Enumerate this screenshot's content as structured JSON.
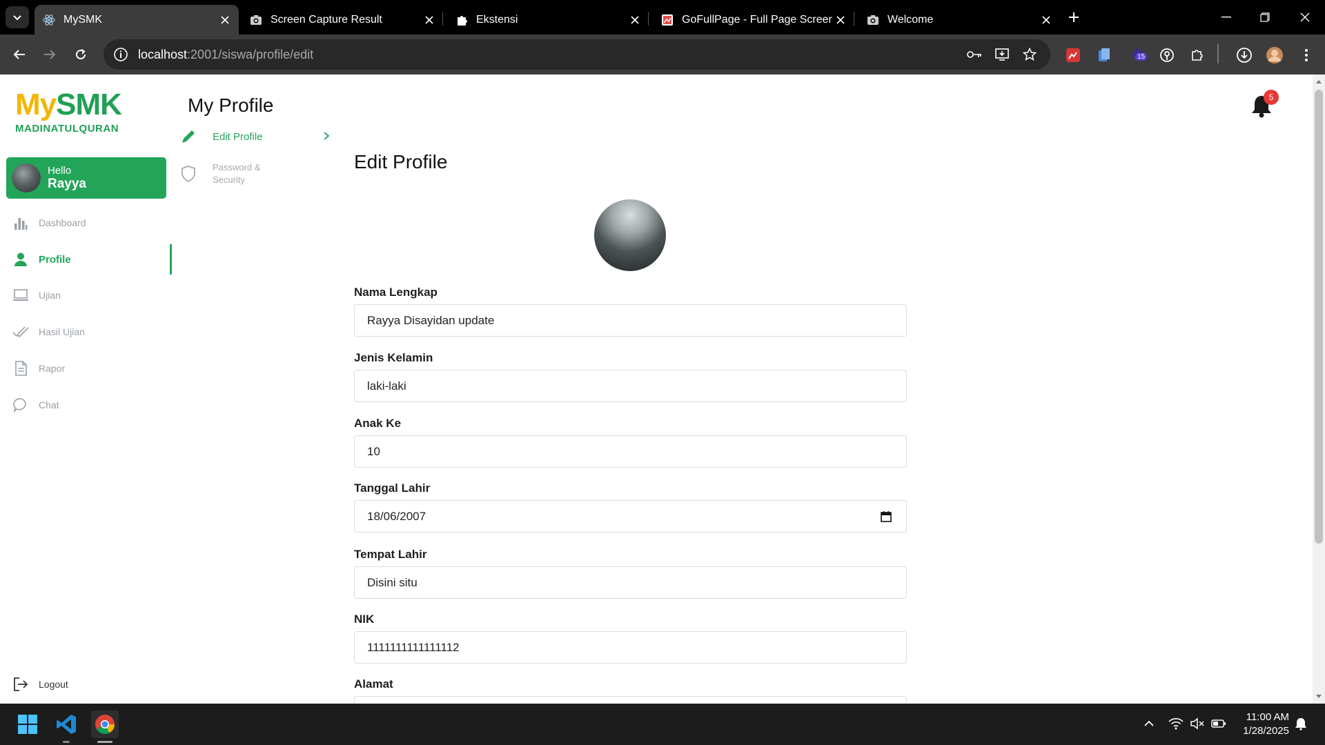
{
  "browser": {
    "tabs": [
      {
        "label": "MySMK",
        "icon": "react-icon",
        "active": true
      },
      {
        "label": "Screen Capture Result",
        "icon": "camera-icon",
        "active": false
      },
      {
        "label": "Ekstensi",
        "icon": "puzzle-icon",
        "active": false
      },
      {
        "label": "GoFullPage - Full Page Screen C",
        "icon": "gofullpage-icon",
        "active": false
      },
      {
        "label": "Welcome",
        "icon": "camera-icon",
        "active": false
      }
    ],
    "url_host": "localhost",
    "url_path": ":2001/siswa/profile/edit",
    "extension_badge": "15"
  },
  "sidebar": {
    "logo_my": "My",
    "logo_smk": "SMK",
    "logo_school": "MADINATULQURAN",
    "greeting": "Hello",
    "username": "Rayya",
    "items": [
      {
        "label": "Dashboard",
        "icon": "bar-chart-icon",
        "active": false
      },
      {
        "label": "Profile",
        "icon": "user-icon",
        "active": true
      },
      {
        "label": "Ujian",
        "icon": "laptop-icon",
        "active": false
      },
      {
        "label": "Hasil Ujian",
        "icon": "check-icon",
        "active": false
      },
      {
        "label": "Rapor",
        "icon": "document-icon",
        "active": false
      },
      {
        "label": "Chat",
        "icon": "chat-icon",
        "active": false
      }
    ],
    "logout": "Logout"
  },
  "header": {
    "title": "My Profile",
    "notification_count": "5"
  },
  "submenu": {
    "edit_profile": "Edit Profile",
    "password_line1": "Password &",
    "password_line2": "Security"
  },
  "form": {
    "title": "Edit Profile",
    "fields": [
      {
        "label": "Nama Lengkap",
        "value": "Rayya Disayidan update"
      },
      {
        "label": "Jenis Kelamin",
        "value": "laki-laki"
      },
      {
        "label": "Anak Ke",
        "value": "10"
      },
      {
        "label": "Tanggal Lahir",
        "value": "18/06/2007"
      },
      {
        "label": "Tempat Lahir",
        "value": "Disini situ"
      },
      {
        "label": "NIK",
        "value": "1111111111111112"
      },
      {
        "label": "Alamat",
        "value": ""
      }
    ]
  },
  "taskbar": {
    "time": "11:00 AM",
    "date": "1/28/2025"
  },
  "colors": {
    "brand_green": "#22a559",
    "brand_yellow": "#f2b705",
    "badge_red": "#e53935"
  }
}
